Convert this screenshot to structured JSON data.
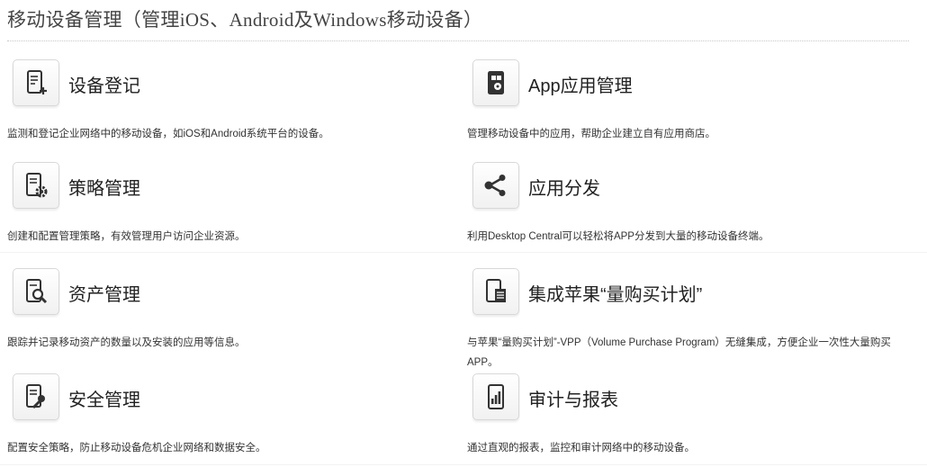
{
  "page": {
    "title": "移动设备管理（管理iOS、Android及Windows移动设备）"
  },
  "features": [
    {
      "title": "设备登记",
      "description": "监测和登记企业网络中的移动设备，如iOS和Android系统平台的设备。",
      "icon": "phone-add-icon"
    },
    {
      "title": "App应用管理",
      "description": "管理移动设备中的应用，帮助企业建立自有应用商店。",
      "icon": "app-management-icon"
    },
    {
      "title": "策略管理",
      "description": "创建和配置管理策略，有效管理用户访问企业资源。",
      "icon": "policy-gear-icon"
    },
    {
      "title": "应用分发",
      "description": "利用Desktop Central可以轻松将APP分发到大量的移动设备终端。",
      "icon": "share-icon"
    },
    {
      "title": "资产管理",
      "description": "跟踪并记录移动资产的数量以及安装的应用等信息。",
      "icon": "asset-search-icon"
    },
    {
      "title": "集成苹果“量购买计划”",
      "description": "与苹果“量购买计划”-VPP（Volume  Purchase  Program）无缝集成，方便企业一次性大量购买APP。",
      "icon": "vpp-document-icon"
    },
    {
      "title": "安全管理",
      "description": "配置安全策略，防止移动设备危机企业网络和数据安全。",
      "icon": "security-key-icon"
    },
    {
      "title": "审计与报表",
      "description": "通过直观的报表，监控和审计网络中的移动设备。",
      "icon": "report-chart-icon"
    }
  ]
}
